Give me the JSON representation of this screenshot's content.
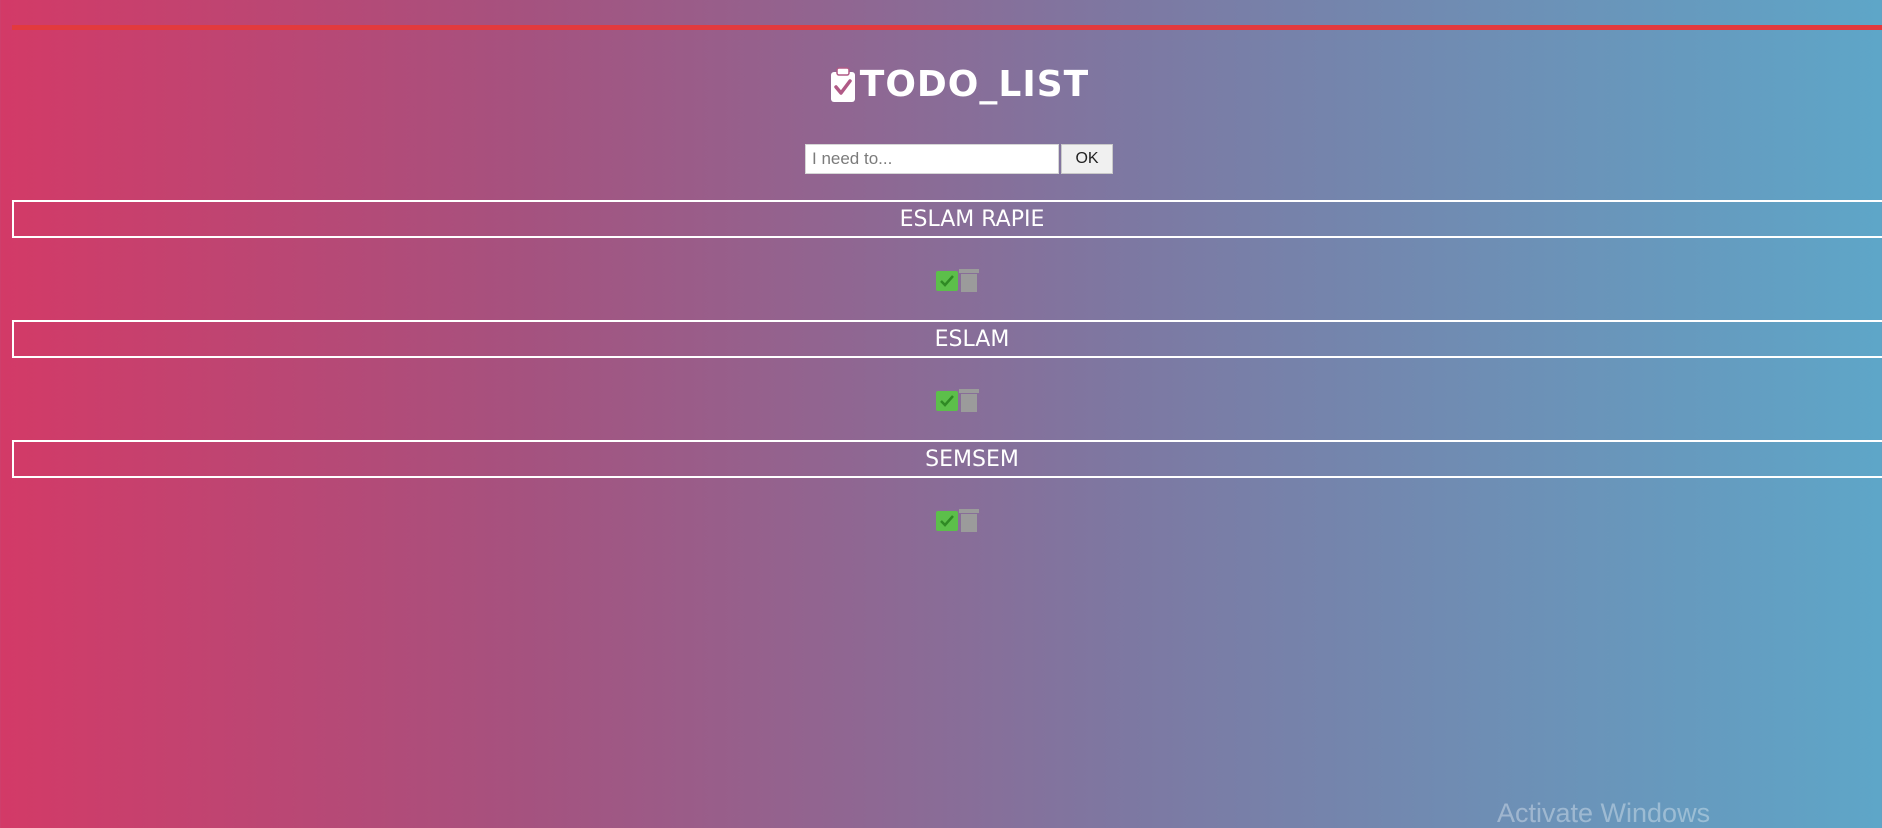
{
  "app": {
    "title": "TODO_LIST",
    "title_icon": "clipboard-check-icon"
  },
  "form": {
    "input_placeholder": "I need to...",
    "input_value": "",
    "ok_label": "OK"
  },
  "todos": [
    {
      "text": "ESLAM RAPIE"
    },
    {
      "text": "ESLAM"
    },
    {
      "text": "SEMSEM"
    }
  ],
  "icons": {
    "check": "check-square-icon",
    "trash": "trash-icon"
  },
  "colors": {
    "accent_bar": "#e23a3e",
    "gradient_left": "#d33a67",
    "gradient_right": "#5ea6c8",
    "check_green": "#5cbf4a",
    "trash_gray": "#9b9b9b"
  },
  "watermark": "Activate Windows"
}
